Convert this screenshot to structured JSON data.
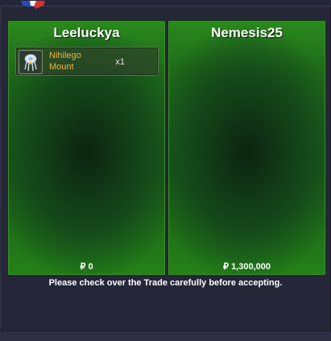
{
  "trade": {
    "left": {
      "player": "Leeluckya",
      "items": [
        {
          "name": "Nihilego Mount",
          "quantity": "x1",
          "icon": "nihilego-icon"
        }
      ],
      "money_symbol": "₽",
      "money": "0"
    },
    "right": {
      "player": "Nemesis25",
      "items": [],
      "money_symbol": "₽",
      "money": "1,300,000"
    },
    "notice": "Please check over the Trade carefully before accepting."
  },
  "colors": {
    "panel_green": "#1f6a1a",
    "window_bg": "#252638",
    "item_name": "#f0b43a"
  }
}
